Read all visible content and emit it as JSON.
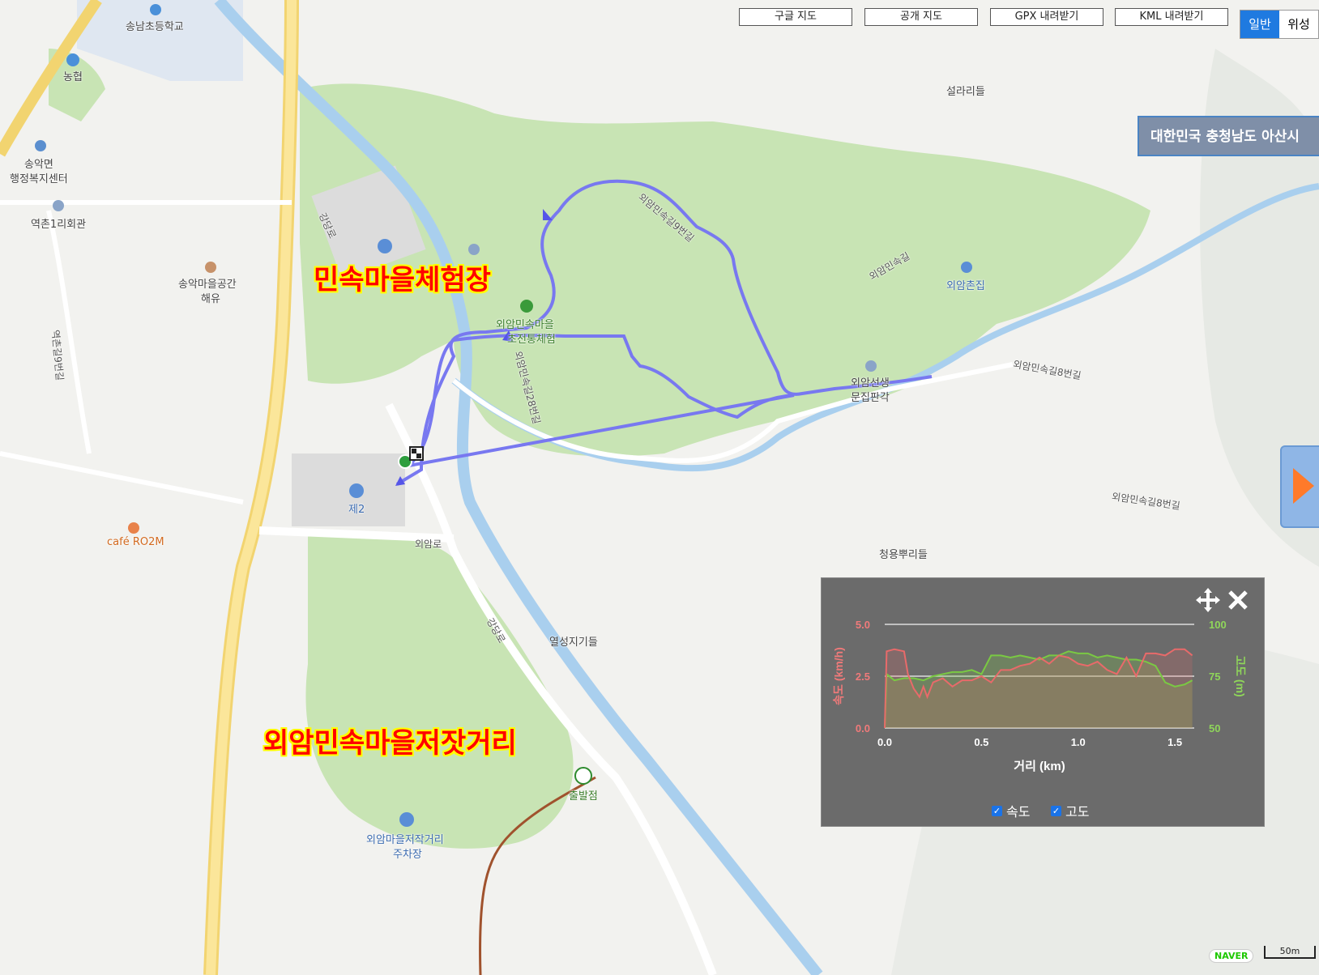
{
  "toolbar": {
    "google_map": "구글 지도",
    "open_map": "공개 지도",
    "gpx_download": "GPX 내려받기",
    "kml_download": "KML 내려받기",
    "map_type_normal": "일반",
    "map_type_satellite": "위성"
  },
  "region_label": "대한민국 충청남도 아산시",
  "overlay_labels": {
    "folk_village_experience": "민속마을체험장",
    "folk_village_market": "외암민속마을저잣거리"
  },
  "map_labels": {
    "songnam_school": "송남초등학교",
    "nonghyup": "농협",
    "songak_myeon": "송악면",
    "welfare_center": "행정복지센터",
    "yeokchon_hall": "역촌1리회관",
    "songak_space_1": "송악마을공간",
    "songak_space_2": "해유",
    "cafe": "café RO2M",
    "parking2": "제2",
    "oeam_road": "외암로",
    "gangdang_road": "강당로",
    "seollari": "설라리들",
    "oeam_village_1": "외암민속마을",
    "oeam_village_2": "초전통체험",
    "oeamchon": "외암촌집",
    "oeam_seonsaeng": "외암선생",
    "munjip": "문집판각",
    "yeolseong": "열성지기들",
    "cheongyong": "청용뿌리들",
    "start_point": "출발점",
    "market_parking_1": "외암마을저작거리",
    "market_parking_2": "주차장",
    "road_9": "외암민속길9번길",
    "road_8": "외암민속길8번길",
    "road_28": "외암민속길28번길",
    "road_main": "외암민속길",
    "road_yeokchon": "역촌길9번길"
  },
  "chart_data": {
    "type": "line",
    "xlabel": "거리 (km)",
    "ylabel_left": "속도 (km/h)",
    "ylabel_right": "고도 (m)",
    "xlim": [
      0,
      1.6
    ],
    "ylim_left": [
      0,
      5.0
    ],
    "ylim_right": [
      50,
      100
    ],
    "x_ticks": [
      "0.0",
      "0.5",
      "1.0",
      "1.5"
    ],
    "y_left_ticks": [
      "0.0",
      "2.5",
      "5.0"
    ],
    "y_right_ticks": [
      "50",
      "75",
      "100"
    ],
    "series": [
      {
        "name": "속도",
        "color": "#e86a6a",
        "x": [
          0.0,
          0.01,
          0.05,
          0.1,
          0.12,
          0.15,
          0.18,
          0.2,
          0.22,
          0.25,
          0.3,
          0.35,
          0.4,
          0.45,
          0.5,
          0.55,
          0.6,
          0.65,
          0.7,
          0.75,
          0.8,
          0.85,
          0.9,
          0.95,
          1.0,
          1.05,
          1.1,
          1.15,
          1.2,
          1.25,
          1.3,
          1.35,
          1.4,
          1.45,
          1.5,
          1.55,
          1.59
        ],
        "values": [
          0.0,
          3.7,
          3.8,
          3.7,
          2.6,
          1.9,
          1.5,
          2.0,
          1.5,
          2.2,
          2.4,
          2.0,
          2.3,
          2.3,
          2.5,
          2.2,
          2.8,
          2.8,
          3.0,
          3.1,
          3.4,
          3.1,
          3.5,
          3.4,
          3.1,
          3.0,
          3.2,
          2.8,
          2.6,
          3.4,
          2.5,
          3.6,
          3.6,
          3.5,
          3.8,
          3.8,
          3.5
        ]
      },
      {
        "name": "고도",
        "color": "#7ac943",
        "x": [
          0.0,
          0.01,
          0.05,
          0.1,
          0.15,
          0.2,
          0.25,
          0.3,
          0.35,
          0.4,
          0.45,
          0.5,
          0.55,
          0.6,
          0.65,
          0.7,
          0.75,
          0.8,
          0.85,
          0.9,
          0.95,
          1.0,
          1.05,
          1.1,
          1.15,
          1.2,
          1.25,
          1.3,
          1.35,
          1.4,
          1.45,
          1.5,
          1.55,
          1.59
        ],
        "values": [
          50,
          76,
          73,
          74,
          74,
          73,
          75,
          76,
          77,
          77,
          78,
          76,
          85,
          85,
          84,
          85,
          84,
          83,
          85,
          85,
          87,
          86,
          86,
          84,
          85,
          84,
          83,
          83,
          82,
          80,
          72,
          70,
          71,
          73
        ]
      }
    ]
  },
  "legend": {
    "speed": "속도",
    "altitude": "고도"
  },
  "attribution": {
    "naver": "NAVER",
    "scale": "50m"
  }
}
